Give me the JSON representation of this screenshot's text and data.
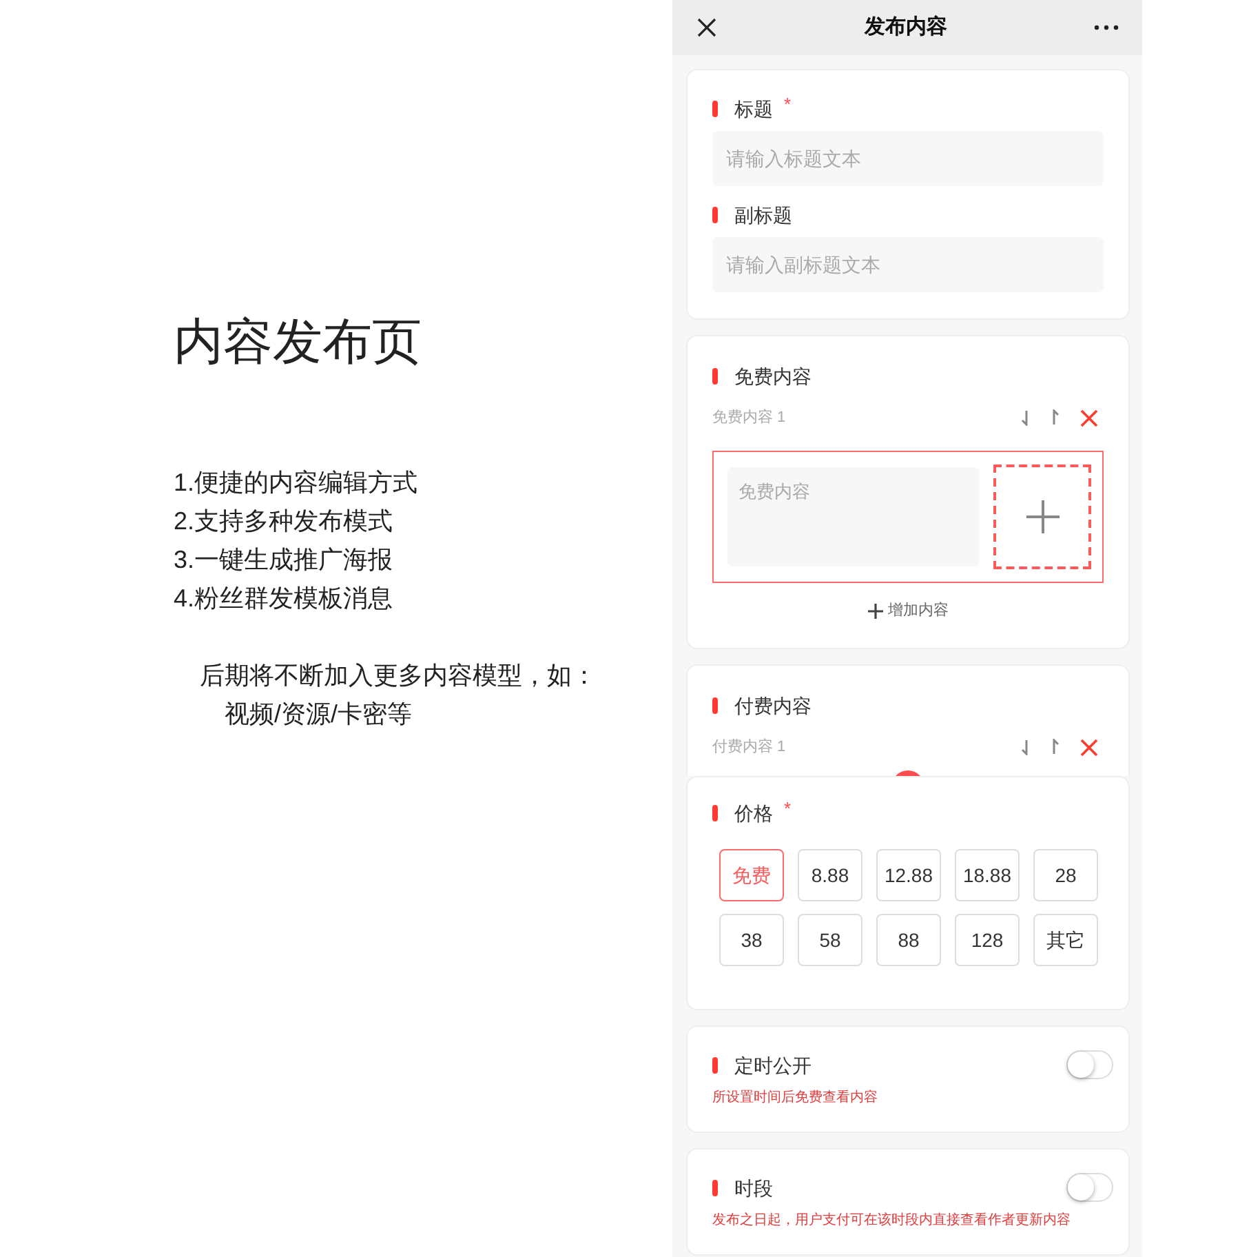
{
  "intro": {
    "title": "内容发布页",
    "features": [
      "1.便捷的内容编辑方式",
      "2.支持多种发布模式",
      "3.一键生成推广海报",
      "4.粉丝群发模板消息"
    ],
    "note": [
      "后期将不断加入更多内容模型，如：",
      "视频/资源/卡密等"
    ]
  },
  "app": {
    "header": {
      "title": "发布内容"
    },
    "sections": [
      {
        "kind": "fields",
        "fields": [
          {
            "label": "标题",
            "required_mark": "*",
            "placeholder": "请输入标题文本"
          },
          {
            "label": "副标题",
            "placeholder": "请输入副标题文本"
          }
        ]
      },
      {
        "kind": "content",
        "label": "免费内容",
        "item_label": "免费内容 1",
        "placeholder": "免费内容",
        "add_label": "增加内容"
      },
      {
        "kind": "content_cut",
        "label": "付费内容",
        "item_label": "付费内容 1"
      },
      {
        "kind": "price",
        "label": "价格",
        "required_mark": "*",
        "options": [
          {
            "label": "免费",
            "selected": true
          },
          {
            "label": "8.88",
            "selected": false
          },
          {
            "label": "12.88",
            "selected": false
          },
          {
            "label": "18.88",
            "selected": false
          },
          {
            "label": "28",
            "selected": false
          },
          {
            "label": "38",
            "selected": false
          },
          {
            "label": "58",
            "selected": false
          },
          {
            "label": "88",
            "selected": false
          },
          {
            "label": "128",
            "selected": false
          },
          {
            "label": "其它",
            "selected": false
          }
        ]
      },
      {
        "kind": "toggle",
        "label": "定时公开",
        "on": false,
        "hint": "所设置时间后免费查看内容"
      },
      {
        "kind": "toggle",
        "label": "时段",
        "on": false,
        "hint": "发布之日起，用户支付可在该时段内直接查看作者更新内容"
      }
    ]
  }
}
